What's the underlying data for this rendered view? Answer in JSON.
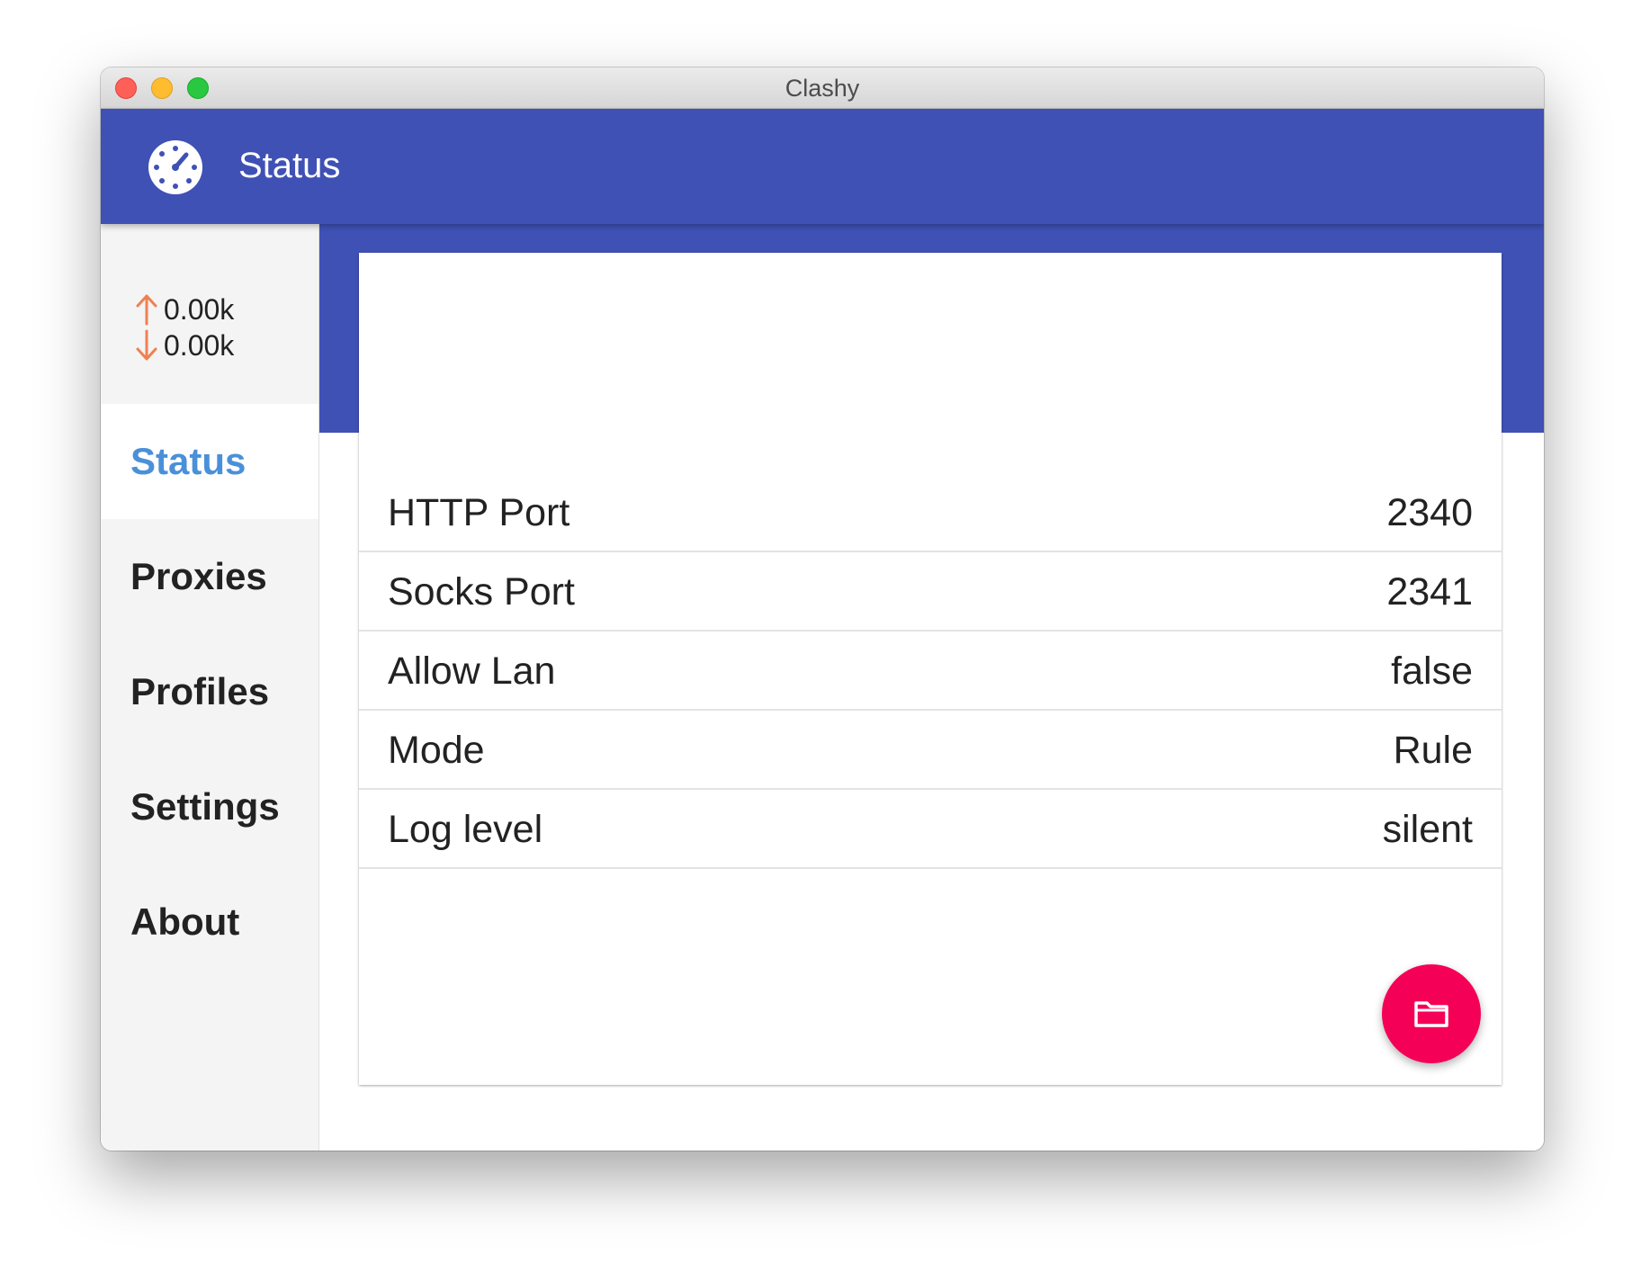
{
  "window": {
    "title": "Clashy"
  },
  "appbar": {
    "title": "Status",
    "icon": "speedometer-icon"
  },
  "traffic": {
    "upload": "0.00k",
    "download": "0.00k",
    "arrow_color": "#f08050"
  },
  "sidebar": {
    "items": [
      {
        "label": "Status",
        "active": true
      },
      {
        "label": "Proxies",
        "active": false
      },
      {
        "label": "Profiles",
        "active": false
      },
      {
        "label": "Settings",
        "active": false
      },
      {
        "label": "About",
        "active": false
      }
    ]
  },
  "status": {
    "rows": [
      {
        "label": "HTTP Port",
        "value": "2340"
      },
      {
        "label": "Socks Port",
        "value": "2341"
      },
      {
        "label": "Allow Lan",
        "value": "false"
      },
      {
        "label": "Mode",
        "value": "Rule"
      },
      {
        "label": "Log level",
        "value": "silent"
      }
    ]
  },
  "fab": {
    "icon": "folder-icon"
  },
  "colors": {
    "primary": "#3f51b5",
    "active_nav": "#4a90d9",
    "fab": "#f50057"
  }
}
